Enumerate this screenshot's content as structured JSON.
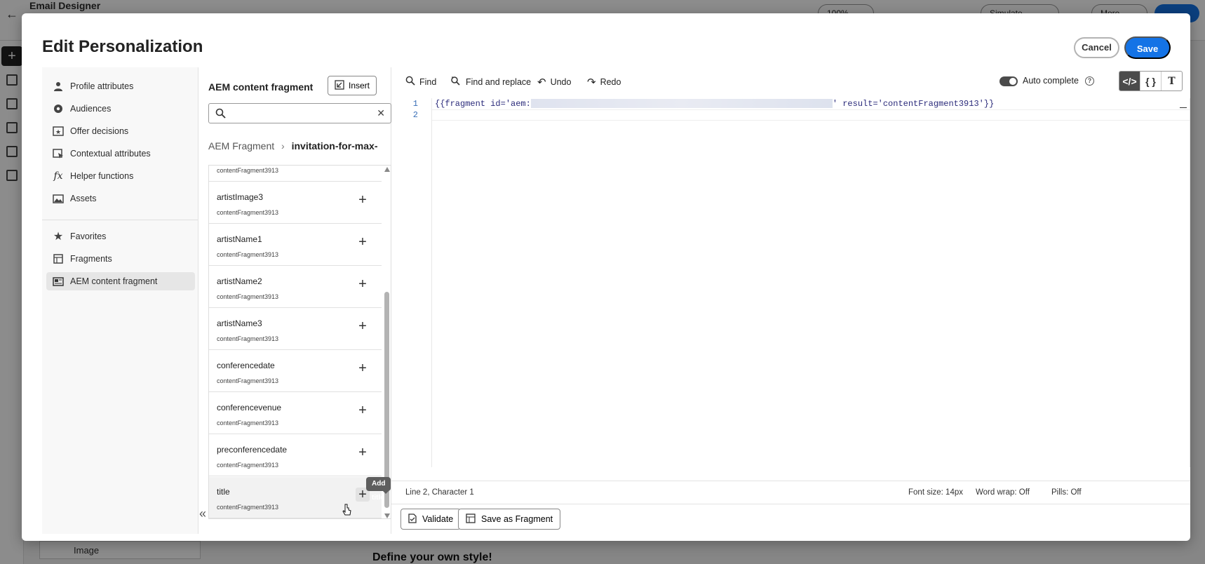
{
  "background": {
    "app_title": "Email Designer",
    "zoom": "100%",
    "simulate_label": "Simulate Content",
    "more_label": "More",
    "image_block_label": "Image",
    "canvas_heading": "Define your own style!"
  },
  "modal": {
    "title": "Edit Personalization",
    "cancel_label": "Cancel",
    "save_label": "Save"
  },
  "nav": {
    "items": [
      {
        "label": "Profile attributes",
        "icon": "person-icon"
      },
      {
        "label": "Audiences",
        "icon": "audience-icon"
      },
      {
        "label": "Offer decisions",
        "icon": "offer-icon"
      },
      {
        "label": "Contextual attributes",
        "icon": "context-icon"
      },
      {
        "label": "Helper functions",
        "icon": "function-icon"
      },
      {
        "label": "Assets",
        "icon": "image-icon"
      },
      {
        "label": "Favorites",
        "icon": "star-icon"
      },
      {
        "label": "Fragments",
        "icon": "fragment-icon"
      },
      {
        "label": "AEM content fragment",
        "icon": "aem-fragment-icon"
      }
    ],
    "active_item": "AEM content fragment"
  },
  "panel": {
    "title": "AEM content fragment",
    "insert_label": "Insert",
    "search_value": "",
    "breadcrumb_root": "AEM Fragment",
    "breadcrumb_current": "invitation-for-max-",
    "items": [
      {
        "name": "",
        "sub": "contentFragment3913"
      },
      {
        "name": "artistImage3",
        "sub": "contentFragment3913"
      },
      {
        "name": "artistName1",
        "sub": "contentFragment3913"
      },
      {
        "name": "artistName2",
        "sub": "contentFragment3913"
      },
      {
        "name": "artistName3",
        "sub": "contentFragment3913"
      },
      {
        "name": "conferencedate",
        "sub": "contentFragment3913"
      },
      {
        "name": "conferencevenue",
        "sub": "contentFragment3913"
      },
      {
        "name": "preconferencedate",
        "sub": "contentFragment3913"
      },
      {
        "name": "title",
        "sub": "contentFragment3913"
      }
    ],
    "tooltip": "Add title"
  },
  "toolbar": {
    "find": "Find",
    "find_replace": "Find and replace",
    "undo": "Undo",
    "redo": "Redo",
    "autocomplete": "Auto complete",
    "autocomplete_on": true,
    "help": "?"
  },
  "editor": {
    "line_numbers": [
      "1",
      "2"
    ],
    "code_prefix": "{{fragment id='aem:",
    "code_suffix": "' result='contentFragment3913'}}"
  },
  "status": {
    "position": "Line 2, Character 1",
    "font_size": "Font size: 14px",
    "word_wrap": "Word wrap: Off",
    "pills": "Pills: Off"
  },
  "footer": {
    "validate": "Validate",
    "save_fragment": "Save as Fragment"
  }
}
